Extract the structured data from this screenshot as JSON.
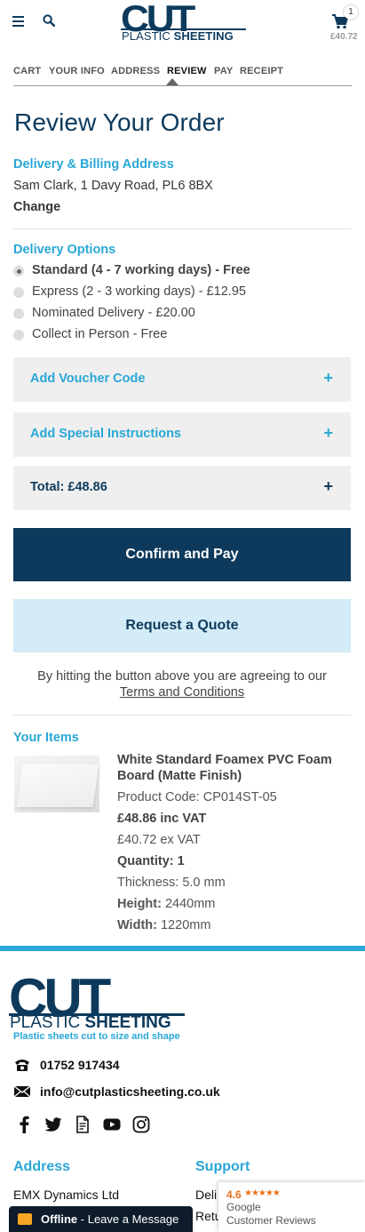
{
  "header": {
    "logo_main": "CUT",
    "logo_sub_light": "PLASTIC ",
    "logo_sub_bold": "SHEETING",
    "cart_count": "1",
    "cart_total": "£40.72",
    "icons": {
      "menu": "hamburger-icon",
      "search": "search-icon",
      "cart": "cart-icon"
    }
  },
  "steps": [
    {
      "label": "CART",
      "active": false
    },
    {
      "label": "YOUR INFO",
      "active": false
    },
    {
      "label": "ADDRESS",
      "active": false
    },
    {
      "label": "REVIEW",
      "active": true
    },
    {
      "label": "PAY",
      "active": false
    },
    {
      "label": "RECEIPT",
      "active": false
    }
  ],
  "page_title": "Review Your Order",
  "address": {
    "heading": "Delivery & Billing Address",
    "value": "Sam Clark, 1 Davy Road, PL6 8BX",
    "change_label": "Change"
  },
  "delivery": {
    "heading": "Delivery Options",
    "options": [
      {
        "label": "Standard (4 - 7 working days) - Free",
        "selected": true
      },
      {
        "label": "Express (2 - 3 working days) - £12.95",
        "selected": false
      },
      {
        "label": "Nominated Delivery - £20.00",
        "selected": false
      },
      {
        "label": "Collect in Person - Free",
        "selected": false
      }
    ]
  },
  "accordions": {
    "voucher": "Add Voucher Code",
    "instructions": "Add Special Instructions",
    "total": "Total: £48.86",
    "plus": "+"
  },
  "buttons": {
    "confirm": "Confirm and Pay",
    "quote": "Request a Quote"
  },
  "agreement": {
    "text": "By hitting the button above you are agreeing to our",
    "link": "Terms and Conditions"
  },
  "items": {
    "heading": "Your Items",
    "list": [
      {
        "name_line1": "White Standard Foamex PVC Foam",
        "name_line2": "Board (Matte Finish)",
        "product_code": "Product Code: CP014ST-05",
        "price_inc": "£48.86 inc VAT",
        "price_ex": "£40.72 ex VAT",
        "quantity": "Quantity: 1",
        "thickness": "Thickness: 5.0 mm",
        "height_label": "Height:",
        "height_value": " 2440mm",
        "width_label": "Width:",
        "width_value": " 1220mm"
      }
    ]
  },
  "footer": {
    "logo_main": "CUT",
    "logo_sub_light": "PLASTIC ",
    "logo_sub_bold": "SHEETING",
    "tagline": "Plastic sheets cut to size and shape",
    "phone": "01752 917434",
    "email": "info@cutplasticsheeting.co.uk",
    "social_icons": [
      "facebook-icon",
      "twitter-icon",
      "document-icon",
      "youtube-icon",
      "instagram-icon"
    ],
    "address_heading": "Address",
    "address_line1": "EMX Dynamics Ltd",
    "support_heading": "Support",
    "support_item1": "Deli",
    "support_item2": "Retu"
  },
  "chat": {
    "status": "Offline",
    "message": " - Leave a Message"
  },
  "google_badge": {
    "score": "4.6",
    "stars": "★★★★★",
    "name": "Google",
    "sub": "Customer Reviews"
  },
  "colors": {
    "brand_navy": "#0d3a5c",
    "accent_blue": "#2aa7d6",
    "quote_bg": "#d3ecf7",
    "panel_bg": "#efefef"
  }
}
